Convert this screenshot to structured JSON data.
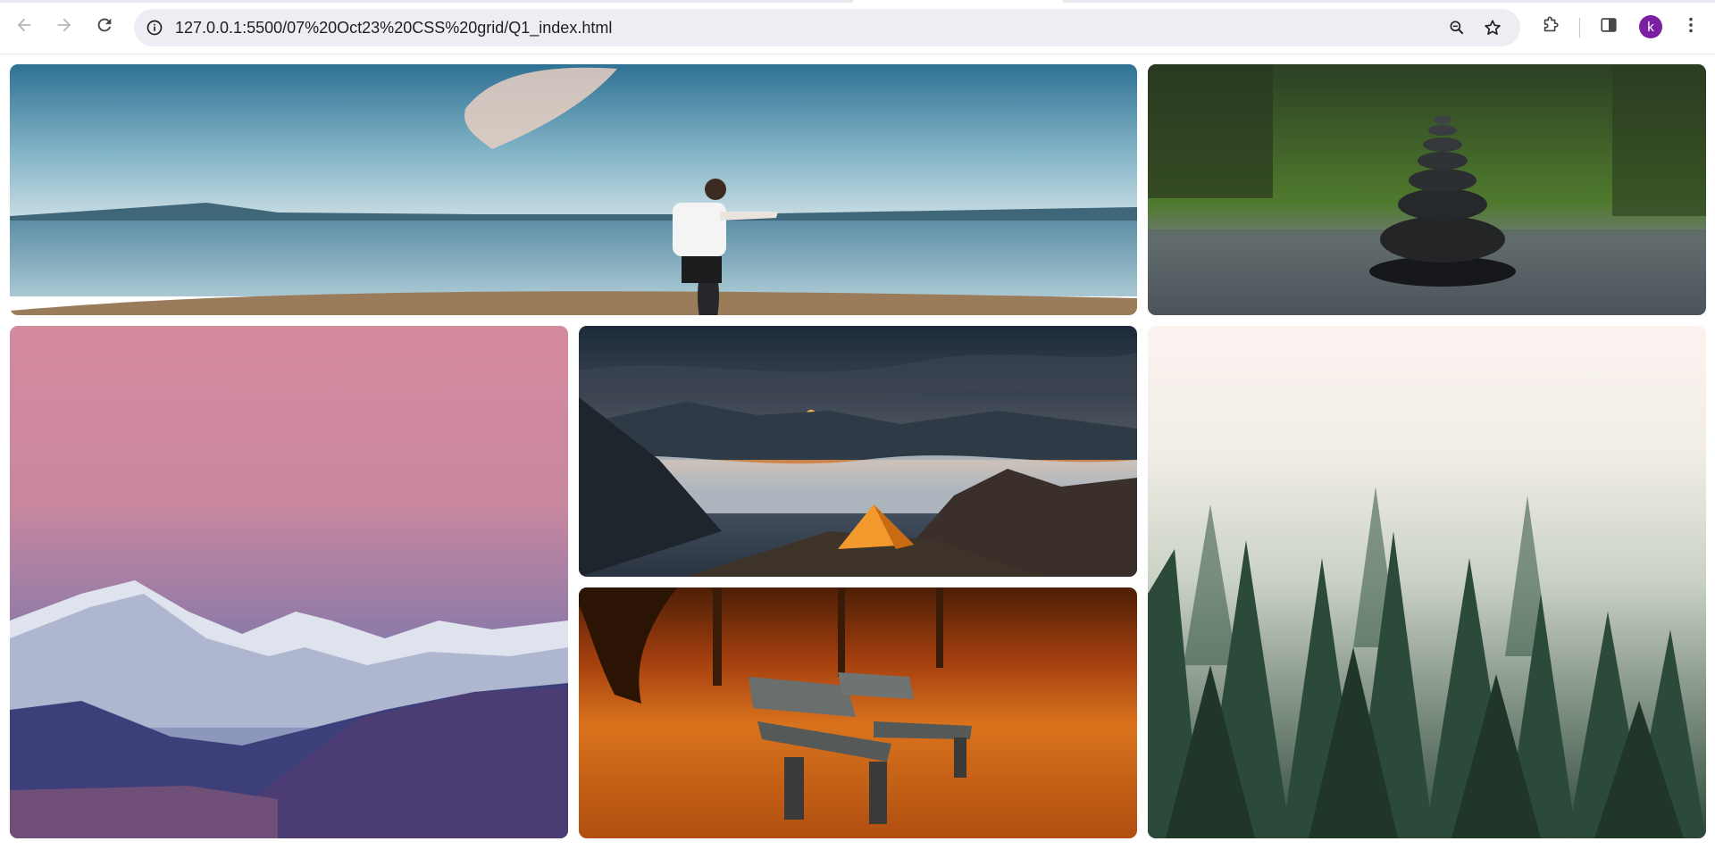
{
  "browser": {
    "url": "127.0.0.1:5500/07%20Oct23%20CSS%20grid/Q1_index.html",
    "profile_initial": "k",
    "icons": {
      "back": "arrow-left-icon",
      "forward": "arrow-right-icon",
      "reload": "reload-icon",
      "site_info": "site-info-icon",
      "zoom": "zoom-icon",
      "bookmark": "star-icon",
      "extensions": "puzzle-icon",
      "side_panel": "side-panel-icon",
      "menu": "kebab-menu-icon"
    },
    "colors": {
      "omnibox": "#eceef3",
      "avatar": "#7b1fa2"
    }
  },
  "gallery": {
    "images": [
      {
        "subject": "person-by-lake"
      },
      {
        "subject": "stacked-stones"
      },
      {
        "subject": "snowy-mountains-pink-sky"
      },
      {
        "subject": "tent-above-clouds"
      },
      {
        "subject": "benches-autumn-leaves"
      },
      {
        "subject": "misty-pine-forest"
      }
    ]
  }
}
